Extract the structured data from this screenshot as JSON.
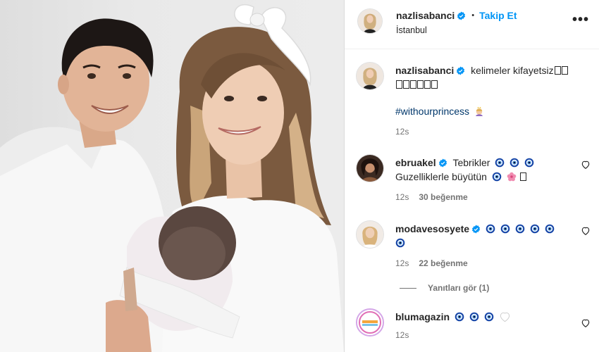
{
  "post": {
    "username": "nazlisabanci",
    "follow_label": "Takip Et",
    "separator": "•",
    "location": "İstanbul",
    "more_label": "•••"
  },
  "caption": {
    "username": "nazlisabanci",
    "text_line1": "kelimeler kifayetsiz",
    "text_line2_glyph_count": 6,
    "hashtag": "#withourprincess",
    "time": "12s"
  },
  "comments": [
    {
      "username": "ebruakel",
      "verified": true,
      "text": "Tebrikler",
      "text_line2": "Guzelliklerle büyütün",
      "time": "12s",
      "likes": "30 beğenme"
    },
    {
      "username": "modavesosyete",
      "verified": true,
      "text": "",
      "time": "12s",
      "likes": "22 beğenme"
    },
    {
      "username": "blumagazin",
      "verified": false,
      "text": "",
      "time": "12s",
      "likes": ""
    }
  ],
  "replies_label": "Yanıtları gör (1)",
  "colors": {
    "accent_blue": "#0095f6",
    "hashtag_blue": "#00376b",
    "muted": "#737373",
    "verified_blue": "#0095f6",
    "nazar_blue": "#1646a8"
  },
  "icons": {
    "verified": "verified-badge-icon",
    "heart": "heart-icon",
    "nazar": "evil-eye-icon",
    "flower": "cherry-blossom-icon",
    "more": "more-options-icon"
  }
}
